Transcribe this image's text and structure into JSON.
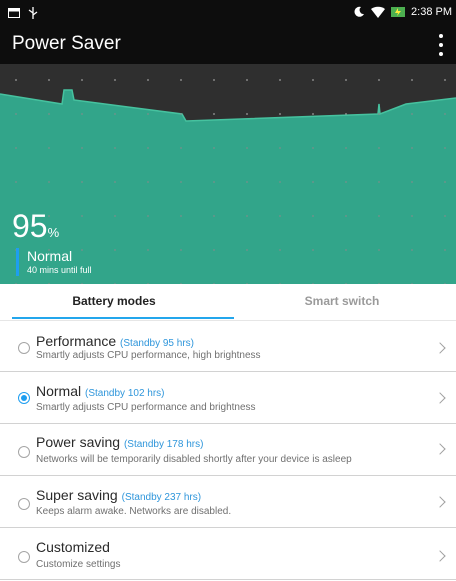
{
  "statusbar": {
    "time": "2:38 PM"
  },
  "appbar": {
    "title": "Power Saver"
  },
  "battery": {
    "percent": "95",
    "unit": "%",
    "mode": "Normal",
    "status": "40 mins until full",
    "graph_color": "#32a58a",
    "accent": "#1e9ef0"
  },
  "tabs": [
    {
      "label": "Battery modes",
      "active": true
    },
    {
      "label": "Smart switch",
      "active": false
    }
  ],
  "modes": [
    {
      "name": "Performance",
      "standby": "(Standby 95 hrs)",
      "desc": "Smartly adjusts CPU performance, high brightness",
      "selected": false
    },
    {
      "name": "Normal",
      "standby": "(Standby 102 hrs)",
      "desc": "Smartly adjusts CPU performance and brightness",
      "selected": true
    },
    {
      "name": "Power saving",
      "standby": "(Standby 178 hrs)",
      "desc": "Networks will be temporarily disabled shortly after your device is asleep",
      "selected": false
    },
    {
      "name": "Super saving",
      "standby": "(Standby 237 hrs)",
      "desc": "Keeps alarm awake. Networks are disabled.",
      "selected": false
    },
    {
      "name": "Customized",
      "standby": "",
      "desc": "Customize settings",
      "selected": false
    }
  ]
}
